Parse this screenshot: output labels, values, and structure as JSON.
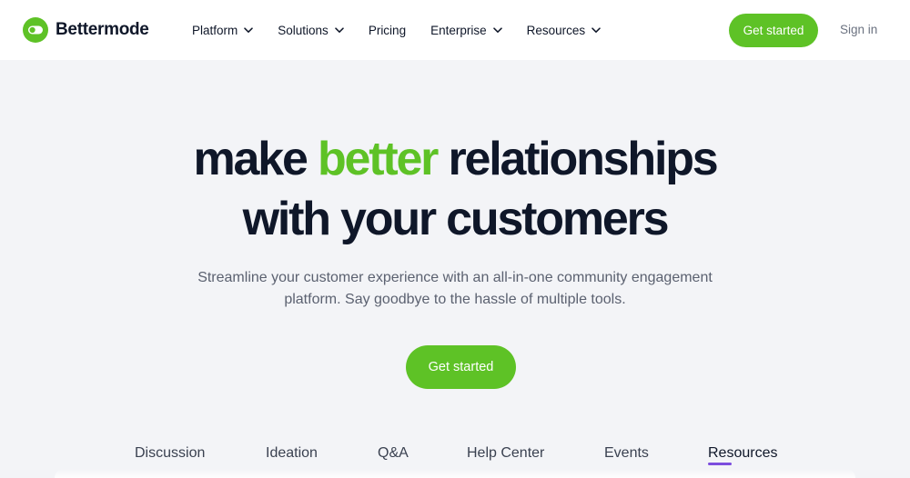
{
  "brand": {
    "name": "Bettermode",
    "color": "#5ec226"
  },
  "nav": {
    "items": [
      {
        "label": "Platform",
        "has_dropdown": true
      },
      {
        "label": "Solutions",
        "has_dropdown": true
      },
      {
        "label": "Pricing",
        "has_dropdown": false
      },
      {
        "label": "Enterprise",
        "has_dropdown": true
      },
      {
        "label": "Resources",
        "has_dropdown": true
      }
    ],
    "cta_label": "Get started",
    "signin_label": "Sign in"
  },
  "hero": {
    "title_part1": "make ",
    "title_accent": "better",
    "title_part2": " relationships",
    "title_line2": "with your customers",
    "subtitle_line1": "Streamline your customer experience with an all-in-one community engagement",
    "subtitle_line2": "platform. Say goodbye to the hassle of multiple tools.",
    "cta_label": "Get started"
  },
  "tabs": {
    "items": [
      {
        "label": "Discussion",
        "active": false
      },
      {
        "label": "Ideation",
        "active": false
      },
      {
        "label": "Q&A",
        "active": false
      },
      {
        "label": "Help Center",
        "active": false
      },
      {
        "label": "Events",
        "active": false
      },
      {
        "label": "Resources",
        "active": true
      }
    ],
    "active_indicator_color": "#7c4dde"
  },
  "colors": {
    "accent": "#5ec226",
    "text_dark": "#0f1729",
    "text_muted": "#5b6170",
    "page_bg": "#f3f4f7",
    "header_bg": "#ffffff"
  }
}
